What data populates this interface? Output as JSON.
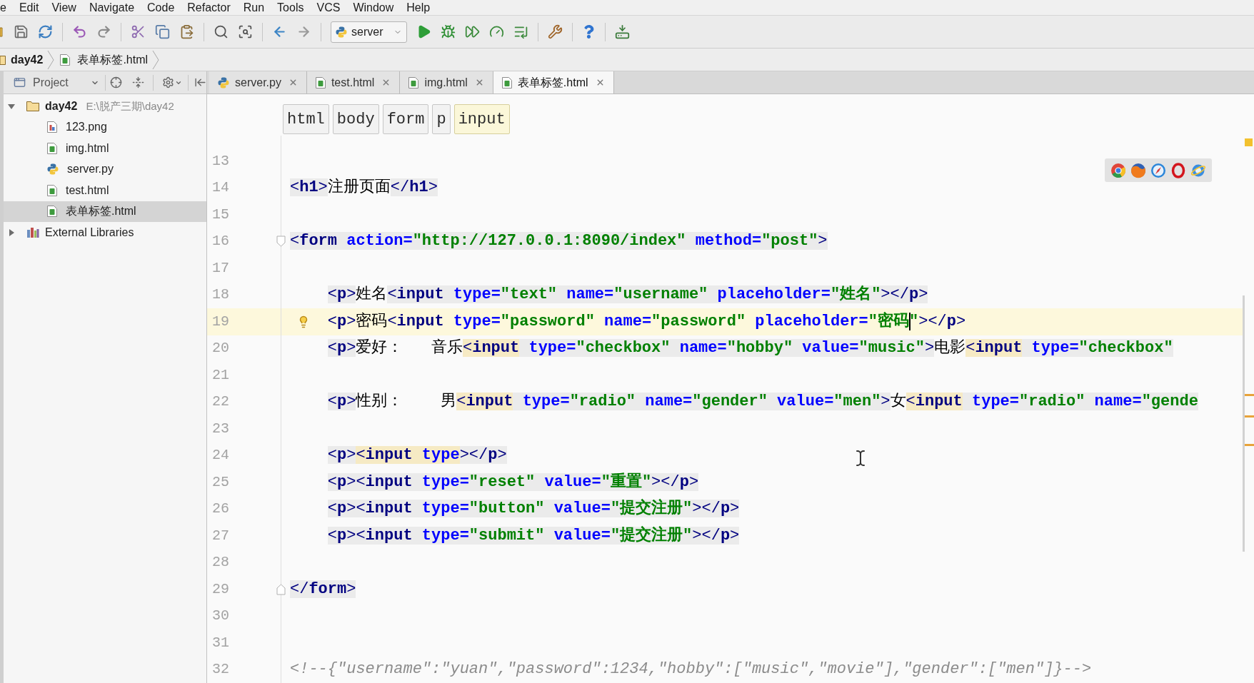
{
  "menu_bar": [
    "e",
    "Edit",
    "View",
    "Navigate",
    "Code",
    "Refactor",
    "Run",
    "Tools",
    "VCS",
    "Window",
    "Help"
  ],
  "toolbar": {
    "run_configuration": "server"
  },
  "navigation_bar": [
    {
      "label": "day42",
      "kind": "folder"
    },
    {
      "label": "表单标签.html",
      "kind": "html"
    }
  ],
  "project_panel": {
    "title": "Project",
    "tree": [
      {
        "label": "day42",
        "kind": "folder",
        "path": "E:\\脱产三期\\day42",
        "expanded": true,
        "selected": false,
        "children": [
          {
            "label": "123.png",
            "kind": "image",
            "selected": false
          },
          {
            "label": "img.html",
            "kind": "html",
            "selected": false
          },
          {
            "label": "server.py",
            "kind": "python",
            "selected": false
          },
          {
            "label": "test.html",
            "kind": "html",
            "selected": false
          },
          {
            "label": "表单标签.html",
            "kind": "html",
            "selected": true
          }
        ]
      },
      {
        "label": "External Libraries",
        "kind": "library",
        "expanded": false,
        "selected": false
      }
    ]
  },
  "editor_tabs": [
    {
      "label": "server.py",
      "kind": "python",
      "selected": false
    },
    {
      "label": "test.html",
      "kind": "html",
      "selected": false
    },
    {
      "label": "img.html",
      "kind": "html",
      "selected": false
    },
    {
      "label": "表单标签.html",
      "kind": "html",
      "selected": true
    }
  ],
  "tag_path": [
    {
      "label": "html",
      "selected": false
    },
    {
      "label": "body",
      "selected": false
    },
    {
      "label": "form",
      "selected": false
    },
    {
      "label": "p",
      "selected": false
    },
    {
      "label": "input",
      "selected": true
    }
  ],
  "editor": {
    "lines": [
      {
        "number": "13",
        "current": false
      },
      {
        "number": "14",
        "current": false,
        "shaded": true,
        "tokens": [
          {
            "kind": "bracket",
            "text": "<"
          },
          {
            "kind": "tag",
            "text": "h1"
          },
          {
            "kind": "bracket",
            "text": ">"
          },
          {
            "kind": "text",
            "text": "注册页面"
          },
          {
            "kind": "bracket",
            "text": "</"
          },
          {
            "kind": "tag",
            "text": "h1"
          },
          {
            "kind": "bracket",
            "text": ">"
          }
        ]
      },
      {
        "number": "15",
        "current": false
      },
      {
        "number": "16",
        "current": false,
        "fold_start": true,
        "shaded": true,
        "tokens": [
          {
            "kind": "bracket",
            "text": "<"
          },
          {
            "kind": "tag",
            "text": "form"
          },
          {
            "kind": "attr",
            "text": " action="
          },
          {
            "kind": "value",
            "text": "\"http://127.0.0.1:8090/index\""
          },
          {
            "kind": "attr",
            "text": " method="
          },
          {
            "kind": "value",
            "text": "\"post\""
          },
          {
            "kind": "bracket",
            "text": ">"
          }
        ]
      },
      {
        "number": "17",
        "current": false
      },
      {
        "number": "18",
        "current": false,
        "indent": true,
        "shaded": true,
        "tokens": [
          {
            "kind": "bracket",
            "text": "<"
          },
          {
            "kind": "tag",
            "text": "p"
          },
          {
            "kind": "bracket",
            "text": ">"
          },
          {
            "kind": "text",
            "text": "姓名"
          },
          {
            "kind": "bracket",
            "text": "<"
          },
          {
            "kind": "tag",
            "text": "input"
          },
          {
            "kind": "attr",
            "text": " type="
          },
          {
            "kind": "value",
            "text": "\"text\""
          },
          {
            "kind": "attr",
            "text": " name="
          },
          {
            "kind": "value",
            "text": "\"username\""
          },
          {
            "kind": "attr",
            "text": " placeholder="
          },
          {
            "kind": "value",
            "text": "\"姓名\""
          },
          {
            "kind": "bracket",
            "text": ">"
          },
          {
            "kind": "bracket",
            "text": "</"
          },
          {
            "kind": "tag",
            "text": "p"
          },
          {
            "kind": "bracket",
            "text": ">"
          }
        ]
      },
      {
        "number": "19",
        "current": true,
        "indent": true,
        "bulb": true,
        "tokens": [
          {
            "kind": "bracket",
            "text": "<"
          },
          {
            "kind": "tag",
            "text": "p"
          },
          {
            "kind": "bracket",
            "text": ">"
          },
          {
            "kind": "text",
            "text": "密码"
          },
          {
            "kind": "bracket",
            "text": "<"
          },
          {
            "kind": "tag",
            "text": "input"
          },
          {
            "kind": "attr",
            "text": " type="
          },
          {
            "kind": "value",
            "text": "\"password\""
          },
          {
            "kind": "attr",
            "text": " name="
          },
          {
            "kind": "value",
            "text": "\"password\""
          },
          {
            "kind": "attr",
            "text": " placeholder="
          },
          {
            "kind": "value",
            "text": "\"密码"
          },
          {
            "kind": "value",
            "text": "\"",
            "caret": true
          },
          {
            "kind": "bracket",
            "text": ">"
          },
          {
            "kind": "bracket",
            "text": "</"
          },
          {
            "kind": "tag",
            "text": "p"
          },
          {
            "kind": "bracket",
            "text": ">"
          }
        ]
      },
      {
        "number": "20",
        "current": false,
        "indent": true,
        "shaded": true,
        "tokens": [
          {
            "kind": "bracket",
            "text": "<"
          },
          {
            "kind": "tag",
            "text": "p"
          },
          {
            "kind": "bracket",
            "text": ">"
          },
          {
            "kind": "text",
            "text": "爱好：   音乐"
          },
          {
            "kind": "bracket",
            "text": "<",
            "matched": true
          },
          {
            "kind": "tag",
            "text": "input",
            "matched": true
          },
          {
            "kind": "attr",
            "text": " type="
          },
          {
            "kind": "value",
            "text": "\"checkbox\""
          },
          {
            "kind": "attr",
            "text": " name="
          },
          {
            "kind": "value",
            "text": "\"hobby\""
          },
          {
            "kind": "attr",
            "text": " value="
          },
          {
            "kind": "value",
            "text": "\"music\""
          },
          {
            "kind": "bracket",
            "text": ">"
          },
          {
            "kind": "text",
            "text": "电影"
          },
          {
            "kind": "bracket",
            "text": "<",
            "matched": true
          },
          {
            "kind": "tag",
            "text": "input",
            "matched": true
          },
          {
            "kind": "attr",
            "text": " type="
          },
          {
            "kind": "value",
            "text": "\"checkbox\""
          }
        ]
      },
      {
        "number": "21",
        "current": false
      },
      {
        "number": "22",
        "current": false,
        "indent": true,
        "shaded": true,
        "tokens": [
          {
            "kind": "bracket",
            "text": "<"
          },
          {
            "kind": "tag",
            "text": "p"
          },
          {
            "kind": "bracket",
            "text": ">"
          },
          {
            "kind": "text",
            "text": "性别：    男"
          },
          {
            "kind": "bracket",
            "text": "<",
            "matched": true
          },
          {
            "kind": "tag",
            "text": "input",
            "matched": true
          },
          {
            "kind": "attr",
            "text": " type="
          },
          {
            "kind": "value",
            "text": "\"radio\""
          },
          {
            "kind": "attr",
            "text": " name="
          },
          {
            "kind": "value",
            "text": "\"gender\""
          },
          {
            "kind": "attr",
            "text": " value="
          },
          {
            "kind": "value",
            "text": "\"men\""
          },
          {
            "kind": "bracket",
            "text": ">"
          },
          {
            "kind": "text",
            "text": "女"
          },
          {
            "kind": "bracket",
            "text": "<",
            "matched": true
          },
          {
            "kind": "tag",
            "text": "input",
            "matched": true
          },
          {
            "kind": "attr",
            "text": " type="
          },
          {
            "kind": "value",
            "text": "\"radio\""
          },
          {
            "kind": "attr",
            "text": " name="
          },
          {
            "kind": "value",
            "text": "\"gende"
          }
        ]
      },
      {
        "number": "23",
        "current": false
      },
      {
        "number": "24",
        "current": false,
        "indent": true,
        "shaded": true,
        "tokens": [
          {
            "kind": "bracket",
            "text": "<"
          },
          {
            "kind": "tag",
            "text": "p"
          },
          {
            "kind": "bracket",
            "text": ">"
          },
          {
            "kind": "bracket",
            "text": "<",
            "matched": true
          },
          {
            "kind": "tag",
            "text": "input",
            "matched": true
          },
          {
            "kind": "attr",
            "text": " type",
            "matched": true
          },
          {
            "kind": "bracket",
            "text": ">"
          },
          {
            "kind": "bracket",
            "text": "</"
          },
          {
            "kind": "tag",
            "text": "p"
          },
          {
            "kind": "bracket",
            "text": ">"
          }
        ]
      },
      {
        "number": "25",
        "current": false,
        "indent": true,
        "shaded": true,
        "tokens": [
          {
            "kind": "bracket",
            "text": "<"
          },
          {
            "kind": "tag",
            "text": "p"
          },
          {
            "kind": "bracket",
            "text": ">"
          },
          {
            "kind": "bracket",
            "text": "<"
          },
          {
            "kind": "tag",
            "text": "input"
          },
          {
            "kind": "attr",
            "text": " type="
          },
          {
            "kind": "value",
            "text": "\"reset\""
          },
          {
            "kind": "attr",
            "text": " value="
          },
          {
            "kind": "value",
            "text": "\"重置\""
          },
          {
            "kind": "bracket",
            "text": ">"
          },
          {
            "kind": "bracket",
            "text": "</"
          },
          {
            "kind": "tag",
            "text": "p"
          },
          {
            "kind": "bracket",
            "text": ">"
          }
        ]
      },
      {
        "number": "26",
        "current": false,
        "indent": true,
        "shaded": true,
        "tokens": [
          {
            "kind": "bracket",
            "text": "<"
          },
          {
            "kind": "tag",
            "text": "p"
          },
          {
            "kind": "bracket",
            "text": ">"
          },
          {
            "kind": "bracket",
            "text": "<"
          },
          {
            "kind": "tag",
            "text": "input"
          },
          {
            "kind": "attr",
            "text": " type="
          },
          {
            "kind": "value",
            "text": "\"button\""
          },
          {
            "kind": "attr",
            "text": " value="
          },
          {
            "kind": "value",
            "text": "\"提交注册\""
          },
          {
            "kind": "bracket",
            "text": ">"
          },
          {
            "kind": "bracket",
            "text": "</"
          },
          {
            "kind": "tag",
            "text": "p"
          },
          {
            "kind": "bracket",
            "text": ">"
          }
        ]
      },
      {
        "number": "27",
        "current": false,
        "indent": true,
        "shaded": true,
        "tokens": [
          {
            "kind": "bracket",
            "text": "<"
          },
          {
            "kind": "tag",
            "text": "p"
          },
          {
            "kind": "bracket",
            "text": ">"
          },
          {
            "kind": "bracket",
            "text": "<"
          },
          {
            "kind": "tag",
            "text": "input"
          },
          {
            "kind": "attr",
            "text": " type="
          },
          {
            "kind": "value",
            "text": "\"submit\""
          },
          {
            "kind": "attr",
            "text": " value="
          },
          {
            "kind": "value",
            "text": "\"提交注册\""
          },
          {
            "kind": "bracket",
            "text": ">"
          },
          {
            "kind": "bracket",
            "text": "</"
          },
          {
            "kind": "tag",
            "text": "p"
          },
          {
            "kind": "bracket",
            "text": ">"
          }
        ]
      },
      {
        "number": "28",
        "current": false
      },
      {
        "number": "29",
        "current": false,
        "fold_end": true,
        "shaded": true,
        "tokens": [
          {
            "kind": "bracket",
            "text": "</"
          },
          {
            "kind": "tag",
            "text": "form"
          },
          {
            "kind": "bracket",
            "text": ">"
          }
        ]
      },
      {
        "number": "30",
        "current": false
      },
      {
        "number": "31",
        "current": false
      },
      {
        "number": "32",
        "current": false,
        "tokens": [
          {
            "kind": "comment",
            "text": "<!--{\"username\":\"yuan\",\"password\":1234,\"hobby\":[\"music\",\"movie\"],\"gender\":[\"men\"]}-->"
          }
        ]
      }
    ]
  }
}
